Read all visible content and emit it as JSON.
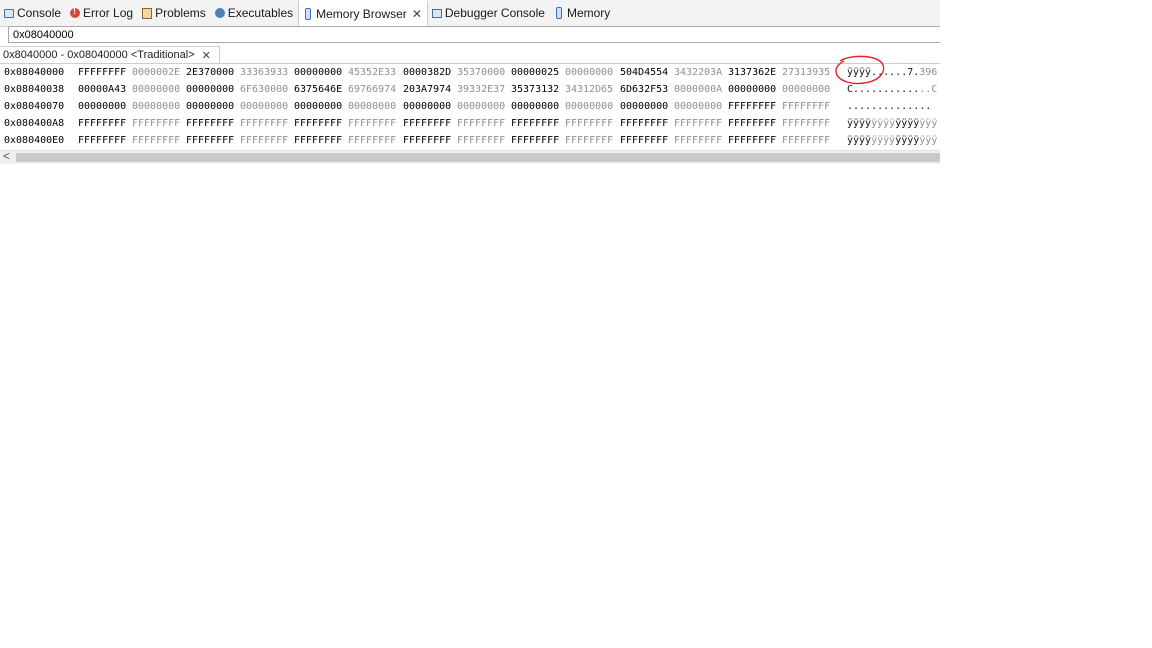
{
  "tabs": [
    {
      "label": "Console",
      "icon": "console-icon"
    },
    {
      "label": "Error Log",
      "icon": "error-log-icon"
    },
    {
      "label": "Problems",
      "icon": "problems-icon"
    },
    {
      "label": "Executables",
      "icon": "executables-icon"
    },
    {
      "label": "Memory Browser",
      "icon": "memory-browser-icon",
      "active": true,
      "close": "✕"
    },
    {
      "label": "Debugger Console",
      "icon": "debugger-console-icon"
    },
    {
      "label": "Memory",
      "icon": "memory-icon"
    }
  ],
  "address_input": {
    "value": "0x08040000"
  },
  "rendering_tab": {
    "label": "0x8040000 - 0x08040000 <Traditional>",
    "close": "✕"
  },
  "memory_rows": [
    {
      "address": "0x08040000",
      "words": [
        "FFFFFFFF",
        "0000002E",
        "2E370000",
        "33363933",
        "00000000",
        "45352E33",
        "0000382D",
        "35370000",
        "00000025",
        "00000000",
        "504D4554",
        "3432203A",
        "3137362E",
        "27313935"
      ],
      "ascii_bright": "ÿÿÿÿ.",
      "ascii_dim": "",
      "ascii_tail": ".....7.",
      "ascii_tail_dim": "396"
    },
    {
      "address": "0x08040038",
      "words": [
        "00000A43",
        "00000000",
        "00000000",
        "6F630000",
        "6375646E",
        "69766974",
        "203A7974",
        "39332E37",
        "35373132",
        "34312D65",
        "6D632F53",
        "0000000A",
        "00000000",
        "00000000"
      ],
      "ascii_bright": "C...........",
      "ascii_dim": "",
      "ascii_tail": "",
      "ascii_tail_dim": "..C"
    },
    {
      "address": "0x08040070",
      "words": [
        "00000000",
        "00000000",
        "00000000",
        "00000000",
        "00000000",
        "00000000",
        "00000000",
        "00000000",
        "00000000",
        "00000000",
        "00000000",
        "00000000",
        "FFFFFFFF",
        "FFFFFFFF"
      ],
      "ascii_bright": "..............",
      "ascii_dim": "",
      "ascii_tail": "",
      "ascii_tail_dim": ""
    },
    {
      "address": "0x080400A8",
      "words": [
        "FFFFFFFF",
        "FFFFFFFF",
        "FFFFFFFF",
        "FFFFFFFF",
        "FFFFFFFF",
        "FFFFFFFF",
        "FFFFFFFF",
        "FFFFFFFF",
        "FFFFFFFF",
        "FFFFFFFF",
        "FFFFFFFF",
        "FFFFFFFF",
        "FFFFFFFF",
        "FFFFFFFF"
      ],
      "ascii_bright": "ÿÿÿÿ",
      "ascii_dim": "ÿÿÿÿ",
      "ascii_tail": "ÿÿÿÿ",
      "ascii_tail_dim": "ÿÿÿ"
    },
    {
      "address": "0x080400E0",
      "words": [
        "FFFFFFFF",
        "FFFFFFFF",
        "FFFFFFFF",
        "FFFFFFFF",
        "FFFFFFFF",
        "FFFFFFFF",
        "FFFFFFFF",
        "FFFFFFFF",
        "FFFFFFFF",
        "FFFFFFFF",
        "FFFFFFFF",
        "FFFFFFFF",
        "FFFFFFFF",
        "FFFFFFFF"
      ],
      "ascii_bright": "ÿÿÿÿ",
      "ascii_dim": "ÿÿÿÿ",
      "ascii_tail": "ÿÿÿÿ",
      "ascii_tail_dim": "ÿÿÿ"
    }
  ],
  "scrollbar": {
    "left_arrow": "<"
  },
  "colors": {
    "word_dim": "#8f8f8f",
    "annotation": "#e0262a"
  }
}
